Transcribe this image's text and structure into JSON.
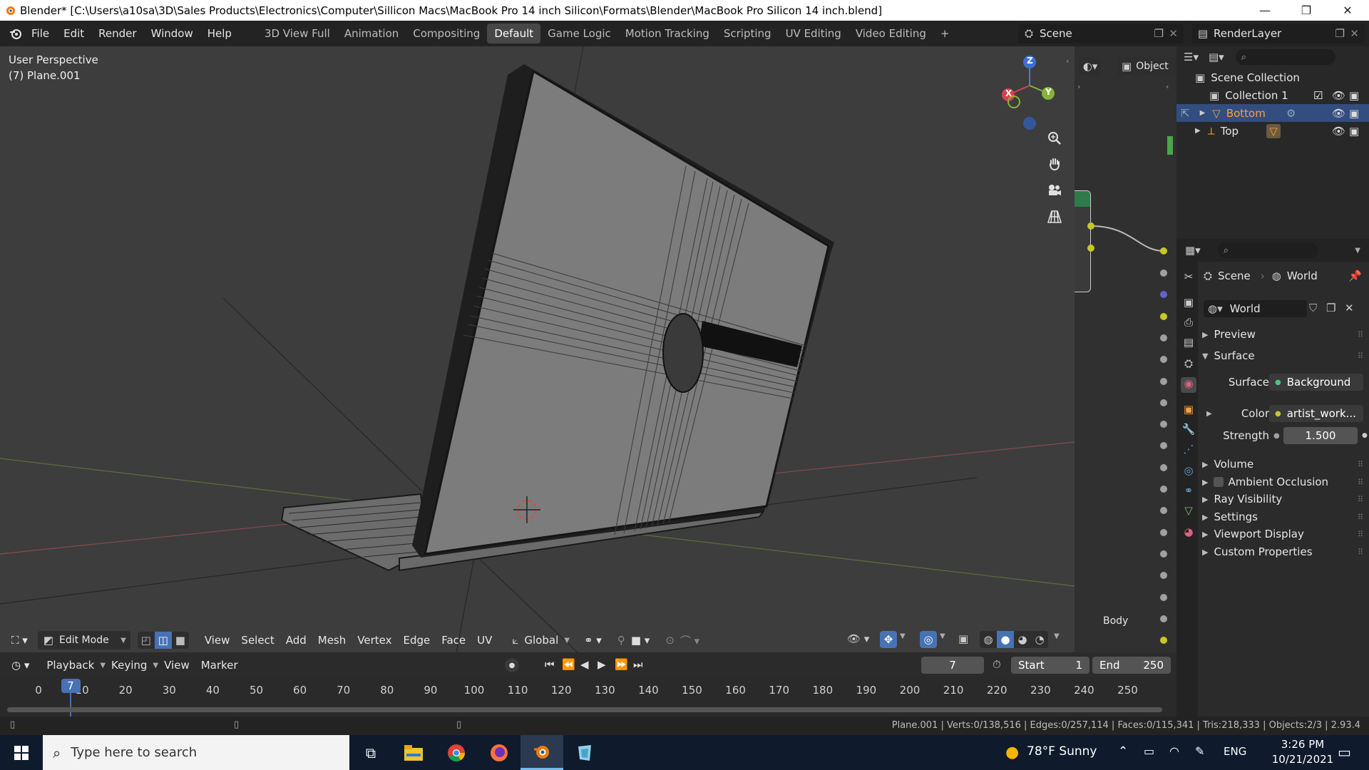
{
  "window": {
    "title": "Blender* [C:\\Users\\a10sa\\3D\\Sales Products\\Electronics\\Computer\\Sillicon Macs\\MacBook Pro 14 inch Silicon\\Formats\\Blender\\MacBook Pro Silicon 14 inch.blend]",
    "minimize": "—",
    "maximize": "❐",
    "close": "✕"
  },
  "menu": [
    "File",
    "Edit",
    "Render",
    "Window",
    "Help"
  ],
  "workspaces": [
    "3D View Full",
    "Animation",
    "Compositing",
    "Default",
    "Game Logic",
    "Motion Tracking",
    "Scripting",
    "UV Editing",
    "Video Editing"
  ],
  "workspace_add": "+",
  "scene_selector": "Scene",
  "render_layer": "RenderLayer",
  "viewport": {
    "view_name": "User Perspective",
    "object_info": "(7) Plane.001",
    "gizmo_axes": [
      "Z",
      "X",
      "Y"
    ],
    "object_button": "Object",
    "body_label": "Body"
  },
  "viewport_header": {
    "mode": "Edit Mode",
    "menus": [
      "View",
      "Select",
      "Add",
      "Mesh",
      "Vertex",
      "Edge",
      "Face",
      "UV"
    ],
    "orientation": "Global"
  },
  "outliner": {
    "root": "Scene Collection",
    "items": [
      {
        "name": "Collection 1"
      },
      {
        "name": "Bottom"
      },
      {
        "name": "Top"
      }
    ]
  },
  "properties": {
    "breadcrumb_scene": "Scene",
    "breadcrumb_world": "World",
    "world_name": "World",
    "panels": {
      "preview": "Preview",
      "surface": "Surface",
      "volume": "Volume",
      "ambient_occlusion": "Ambient Occlusion",
      "ray_visibility": "Ray Visibility",
      "settings": "Settings",
      "viewport_display": "Viewport Display",
      "custom_properties": "Custom Properties"
    },
    "surface_label": "Surface",
    "surface_value": "Background",
    "color_label": "Color",
    "color_value": "artist_work...",
    "strength_label": "Strength",
    "strength_value": "1.500"
  },
  "timeline": {
    "menus": [
      "Playback",
      "Keying",
      "View",
      "Marker"
    ],
    "current_frame": "7",
    "start_label": "Start",
    "start_value": "1",
    "end_label": "End",
    "end_value": "250",
    "ticks": [
      "0",
      "10",
      "20",
      "30",
      "40",
      "50",
      "60",
      "70",
      "80",
      "90",
      "100",
      "110",
      "120",
      "130",
      "140",
      "150",
      "160",
      "170",
      "180",
      "190",
      "200",
      "210",
      "220",
      "230",
      "240",
      "250"
    ],
    "playhead": "7"
  },
  "statusbar": {
    "stats": "Plane.001 | Verts:0/138,516 | Edges:0/257,114 | Faces:0/115,341 | Tris:218,333 | Objects:2/3 | 2.93.4"
  },
  "taskbar": {
    "search_placeholder": "Type here to search",
    "weather": "78°F  Sunny",
    "language": "ENG",
    "time": "3:26 PM",
    "date": "10/21/2021"
  },
  "colors": {
    "accent_blue": "#4772b3",
    "selected_orange": "#f5a041",
    "viewport_bg": "#3d3d3d"
  }
}
